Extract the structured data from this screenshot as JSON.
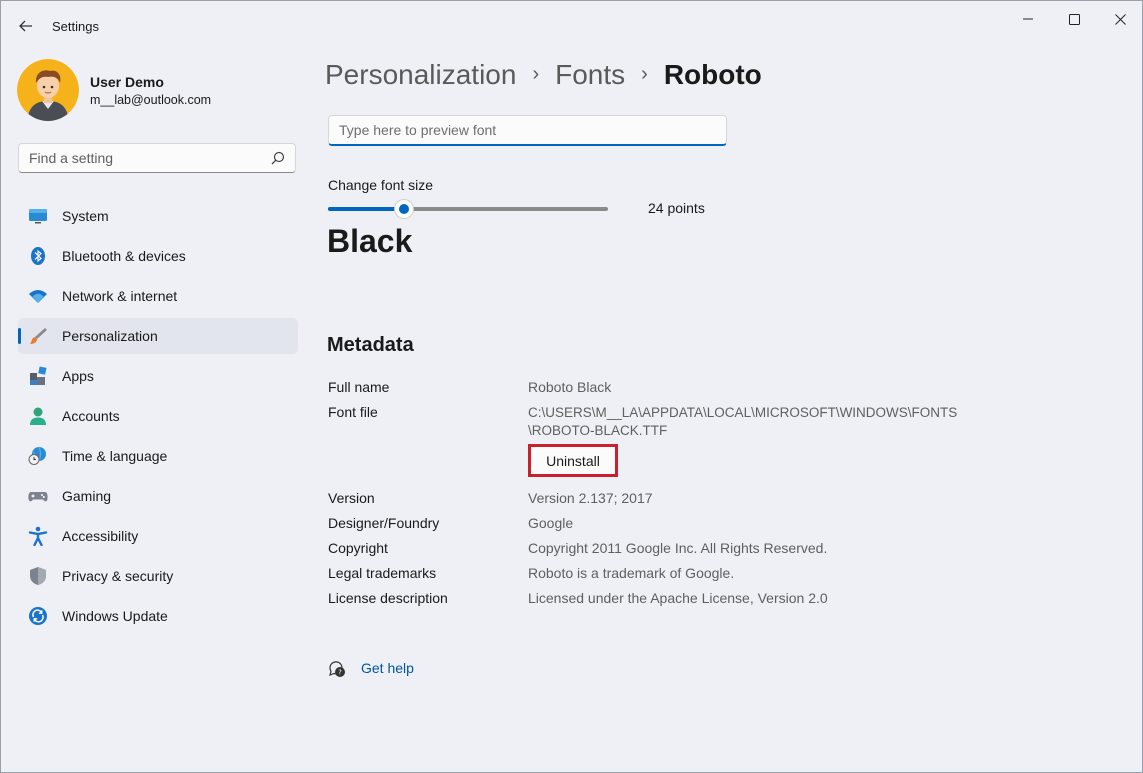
{
  "app": {
    "title": "Settings",
    "accent": "#0067c0",
    "highlight": "#c9202c"
  },
  "user": {
    "name": "User Demo",
    "email": "m__lab@outlook.com"
  },
  "search": {
    "placeholder": "Find a setting"
  },
  "sidebar": {
    "items": [
      {
        "label": "System",
        "icon": "monitor-icon"
      },
      {
        "label": "Bluetooth & devices",
        "icon": "bluetooth-icon"
      },
      {
        "label": "Network & internet",
        "icon": "wifi-icon"
      },
      {
        "label": "Personalization",
        "icon": "brush-icon",
        "active": true
      },
      {
        "label": "Apps",
        "icon": "apps-icon"
      },
      {
        "label": "Accounts",
        "icon": "person-icon"
      },
      {
        "label": "Time & language",
        "icon": "globe-clock-icon"
      },
      {
        "label": "Gaming",
        "icon": "gamepad-icon"
      },
      {
        "label": "Accessibility",
        "icon": "accessibility-icon"
      },
      {
        "label": "Privacy & security",
        "icon": "shield-icon"
      },
      {
        "label": "Windows Update",
        "icon": "update-icon"
      }
    ]
  },
  "breadcrumb": {
    "items": [
      "Personalization",
      "Fonts"
    ],
    "current": "Roboto"
  },
  "preview": {
    "placeholder": "Type here to preview font"
  },
  "font_size": {
    "label": "Change font size",
    "value_text": "24 points",
    "slider_fraction": 0.27
  },
  "sample_text": "Black",
  "metadata": {
    "title": "Metadata",
    "full_name_label": "Full name",
    "full_name": "Roboto Black",
    "font_file_label": "Font file",
    "font_file_line1": "C:\\USERS\\M__LA\\APPDATA\\LOCAL\\MICROSOFT\\WINDOWS\\FONTS",
    "font_file_line2": "\\ROBOTO-BLACK.TTF",
    "uninstall_label": "Uninstall",
    "version_label": "Version",
    "version": "Version 2.137; 2017",
    "designer_label": "Designer/Foundry",
    "designer": "Google",
    "copyright_label": "Copyright",
    "copyright": "Copyright 2011 Google Inc. All Rights Reserved.",
    "trademarks_label": "Legal trademarks",
    "trademarks": "Roboto is a trademark of Google.",
    "license_label": "License description",
    "license": "Licensed under the Apache License, Version 2.0"
  },
  "help": {
    "label": "Get help"
  }
}
